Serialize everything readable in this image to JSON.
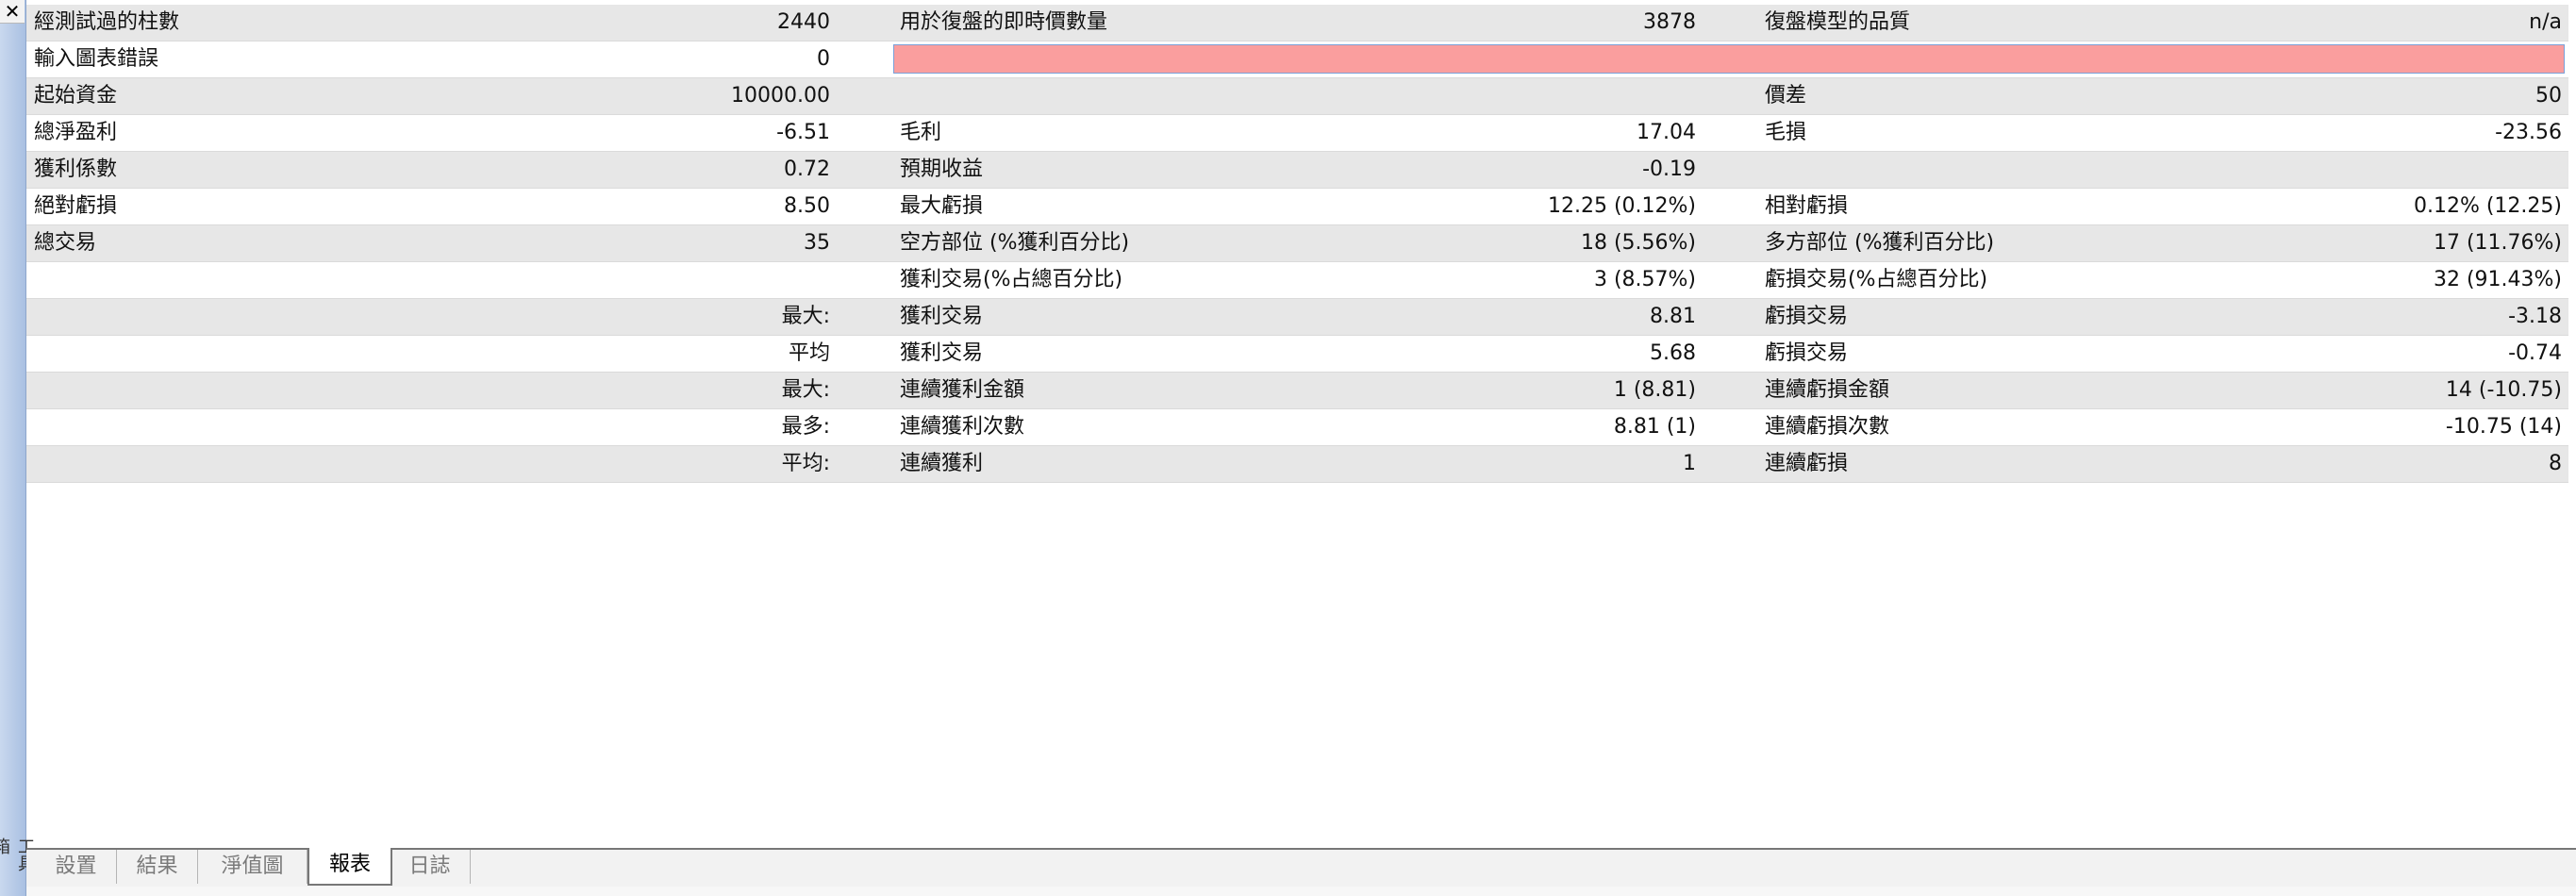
{
  "close_label": "✕",
  "side_label": "工具箱",
  "rows": [
    {
      "c1_label": "經測試過的柱數",
      "c1_value": "2440",
      "c2_label": "用於復盤的即時價數量",
      "c2_value": "3878",
      "c3_label": "復盤模型的品質",
      "c3_value": "n/a"
    },
    {
      "c1_label": "輸入圖表錯誤",
      "c1_value": "0",
      "c2_label": "",
      "c2_value": "",
      "c3_label": "",
      "c3_value": ""
    },
    {
      "c1_label": "起始資金",
      "c1_value": "10000.00",
      "c2_label": "",
      "c2_value": "",
      "c3_label": "價差",
      "c3_value": "50"
    },
    {
      "c1_label": "總淨盈利",
      "c1_value": "-6.51",
      "c2_label": "毛利",
      "c2_value": "17.04",
      "c3_label": "毛損",
      "c3_value": "-23.56"
    },
    {
      "c1_label": "獲利係數",
      "c1_value": "0.72",
      "c2_label": "預期收益",
      "c2_value": "-0.19",
      "c3_label": "",
      "c3_value": ""
    },
    {
      "c1_label": "絕對虧損",
      "c1_value": "8.50",
      "c2_label": "最大虧損",
      "c2_value": "12.25 (0.12%)",
      "c3_label": "相對虧損",
      "c3_value": "0.12% (12.25)"
    },
    {
      "c1_label": "總交易",
      "c1_value": "35",
      "c2_label": "空方部位 (%獲利百分比)",
      "c2_value": "18 (5.56%)",
      "c3_label": "多方部位 (%獲利百分比)",
      "c3_value": "17 (11.76%)"
    },
    {
      "c1_label": "",
      "c1_value": "",
      "c2_label": "獲利交易(%占總百分比)",
      "c2_value": "3 (8.57%)",
      "c3_label": "虧損交易(%占總百分比)",
      "c3_value": "32 (91.43%)"
    },
    {
      "c1_label": "",
      "c1_value": "最大:",
      "c2_label": "獲利交易",
      "c2_value": "8.81",
      "c3_label": "虧損交易",
      "c3_value": "-3.18"
    },
    {
      "c1_label": "",
      "c1_value": "平均",
      "c2_label": "獲利交易",
      "c2_value": "5.68",
      "c3_label": "虧損交易",
      "c3_value": "-0.74"
    },
    {
      "c1_label": "",
      "c1_value": "最大:",
      "c2_label": "連續獲利金額",
      "c2_value": "1 (8.81)",
      "c3_label": "連續虧損金額",
      "c3_value": "14 (-10.75)"
    },
    {
      "c1_label": "",
      "c1_value": "最多:",
      "c2_label": "連續獲利次數",
      "c2_value": "8.81 (1)",
      "c3_label": "連續虧損次數",
      "c3_value": "-10.75 (14)"
    },
    {
      "c1_label": "",
      "c1_value": "平均:",
      "c2_label": "連續獲利",
      "c2_value": "1",
      "c3_label": "連續虧損",
      "c3_value": "8"
    }
  ],
  "tabs": [
    {
      "label": "設置",
      "active": false
    },
    {
      "label": "結果",
      "active": false
    },
    {
      "label": "淨值圖",
      "active": false
    },
    {
      "label": "報表",
      "active": true
    },
    {
      "label": "日誌",
      "active": false
    }
  ],
  "colors": {
    "error_bar": "#fa9e9e",
    "row_shade": "#e7e7e7",
    "side_strip": "#a9c0e2"
  }
}
